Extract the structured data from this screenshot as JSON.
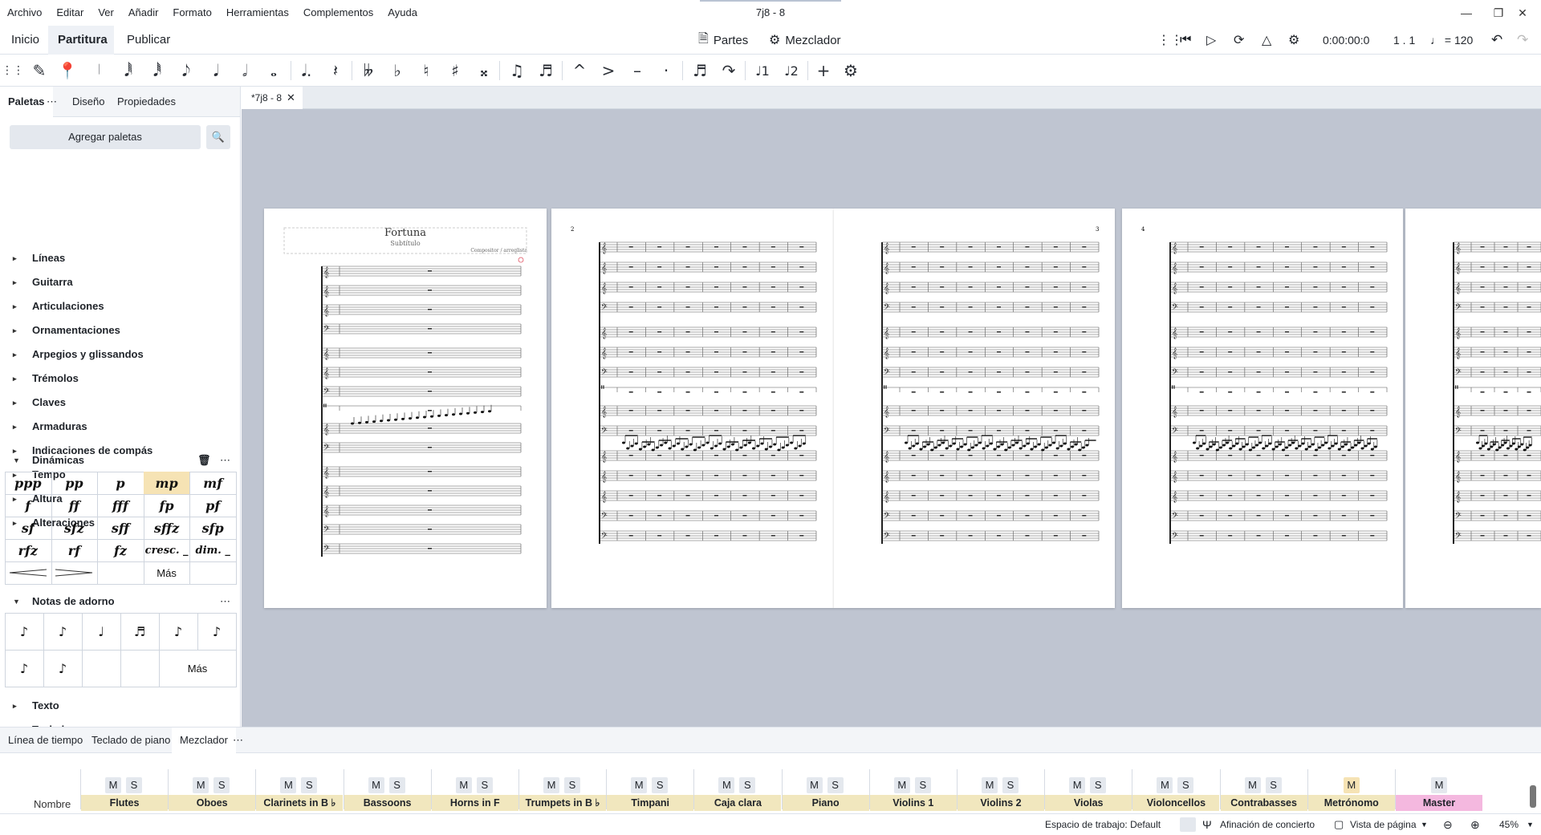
{
  "menu": [
    "Archivo",
    "Editar",
    "Ver",
    "Añadir",
    "Formato",
    "Herramientas",
    "Complementos",
    "Ayuda"
  ],
  "window_title": "7j8 - 8",
  "window_controls": {
    "minimize": "minimize-icon",
    "maximize": "restore-icon",
    "close": "close-icon"
  },
  "mode_tabs": [
    "Inicio",
    "Partitura",
    "Publicar"
  ],
  "active_mode": "Partitura",
  "toolbar": {
    "parts_label": "Partes",
    "mixer_label": "Mezclador",
    "time": "0:00:00:0",
    "position": "1 . 1",
    "tempo": "♩ = 120"
  },
  "note_input": [
    "♬",
    "♪",
    "♩",
    "𝅗𝅥",
    "𝅝"
  ],
  "left_panel": {
    "tabs": [
      "Paletas",
      "Diseño",
      "Propiedades"
    ],
    "add_palettes": "Agregar paletas",
    "palettes_top": [
      "Líneas",
      "Guitarra",
      "Articulaciones",
      "Ornamentaciones",
      "Arpegios y glissandos",
      "Trémolos",
      "Claves",
      "Armaduras",
      "Indicaciones de compás",
      "Tempo",
      "Altura",
      "Alteraciones"
    ],
    "dynamics_title": "Dinámicas",
    "dynamics": [
      "ppp",
      "pp",
      "p",
      "mp",
      "mf",
      "f",
      "ff",
      "fff",
      "fp",
      "pf",
      "sf",
      "sfz",
      "sff",
      "sffz",
      "sfp",
      "rfz",
      "rf",
      "fz",
      "cresc. _",
      "dim. _"
    ],
    "dynamics_selected": "mp",
    "more_label": "Más",
    "grace_title": "Notas de adorno",
    "palettes_bottom": [
      "Texto",
      "Teclado"
    ]
  },
  "document_tab": "*7j8 - 8",
  "score": {
    "title": "Fortuna",
    "subtitle": "Subtítulo",
    "composer": "Compositor / arreglista",
    "page_numbers": [
      "2",
      "3",
      "4"
    ]
  },
  "bottom_tabs": [
    "Línea de tiempo",
    "Teclado de piano",
    "Mezclador"
  ],
  "mixer": {
    "name_label": "Nombre",
    "mute": "M",
    "solo": "S",
    "channels": [
      "Flutes",
      "Oboes",
      "Clarinets in B ♭",
      "Bassoons",
      "Horns in F",
      "Trumpets in B ♭",
      "Timpani",
      "Caja clara",
      "Piano",
      "Violins 1",
      "Violins 2",
      "Violas",
      "Violoncellos",
      "Contrabasses",
      "Metrónomo",
      "Master"
    ]
  },
  "status": {
    "workspace": "Espacio de trabajo: Default",
    "concert_pitch": "Afinación de concierto",
    "view_mode": "Vista de página",
    "zoom": "45%"
  }
}
